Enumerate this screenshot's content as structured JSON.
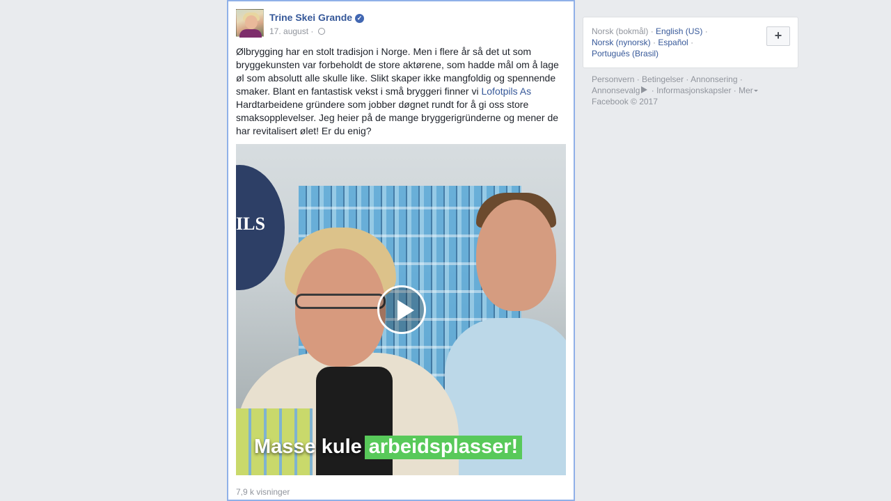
{
  "post": {
    "author": "Trine Skei Grande",
    "date": "17. august",
    "separator": " · ",
    "text_before_link": "Ølbrygging har en stolt tradisjon i Norge. Men i flere år så det ut som bryggekunsten var forbeholdt de store aktørene, som hadde mål om å lage øl som absolutt alle skulle like. Slikt skaper ikke mangfoldig og spennende smaker. Blant en fantastisk vekst i små bryggeri finner vi ",
    "link_text": "Lofotpils As",
    "text_after_link": " Hardtarbeidene gründere som jobber døgnet rundt for å gi oss store smaksopplevelser. Jeg heier på de mange bryggerigründerne og mener de har revitalisert ølet! Er du enig?",
    "video": {
      "caption_part1": "Masse kule",
      "caption_part2": "arbeidsplasser!",
      "logo_text": "ILS"
    },
    "views": "7,9 k visninger"
  },
  "languages": {
    "current": "Norsk (bokmål)",
    "english": "English (US)",
    "nynorsk": "Norsk (nynorsk)",
    "espanol": "Español",
    "portugues": "Português (Brasil)",
    "add_label": "+"
  },
  "footer": {
    "personvern": "Personvern",
    "betingelser": "Betingelser",
    "annonsering": "Annonsering",
    "annonsevalg": "Annonsevalg",
    "informasjonskapsler": "Informasjonskapsler",
    "mer": "Mer",
    "copyright": "Facebook © 2017"
  },
  "colors": {
    "link": "#365899",
    "meta": "#90949c",
    "caption_highlight": "#58c95a",
    "post_border": "#8fb0e8"
  },
  "icons": {
    "verified": "verified-badge-icon",
    "audience": "globe-icon",
    "play": "play-icon",
    "adchoices": "adchoices-icon",
    "more": "caret-down-icon"
  }
}
